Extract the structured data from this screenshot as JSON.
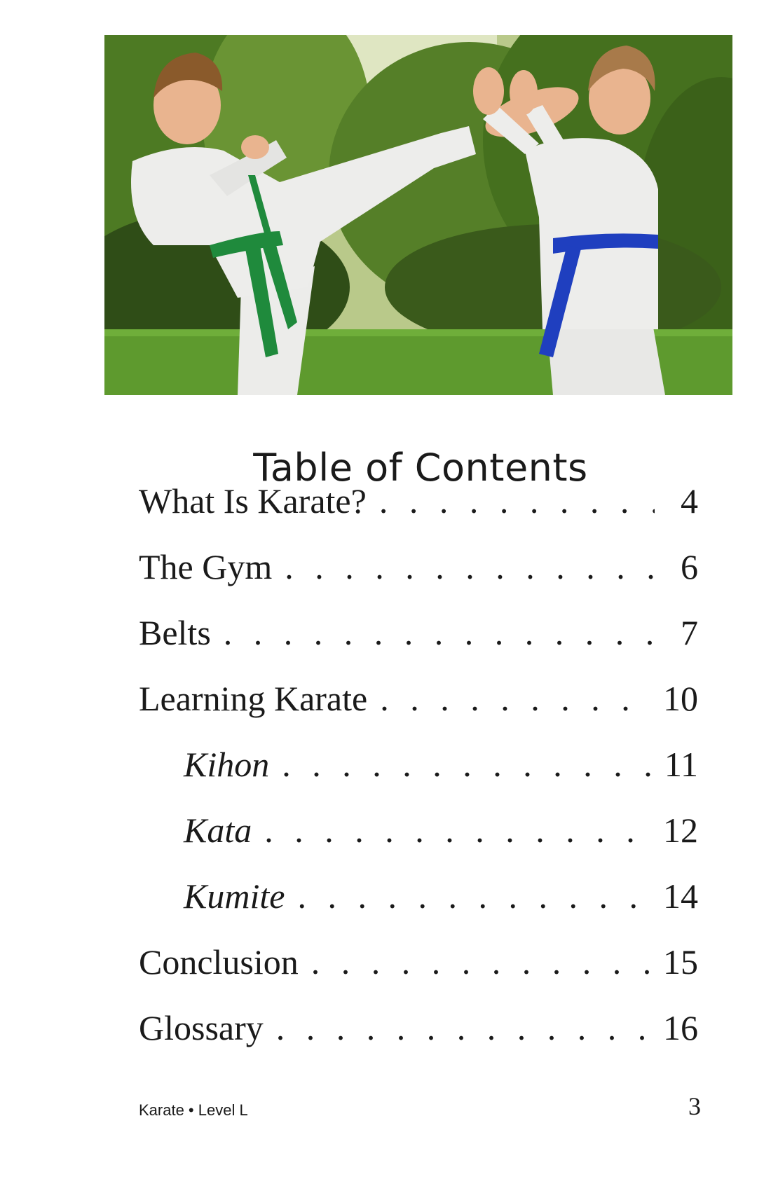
{
  "toc": {
    "title": "Table of Contents",
    "entries": [
      {
        "label": "What Is Karate?",
        "page": "4"
      },
      {
        "label": "The Gym",
        "page": "6"
      },
      {
        "label": "Belts",
        "page": "7"
      },
      {
        "label": "Learning Karate",
        "page": "10"
      },
      {
        "label": "Kihon",
        "page": "11"
      },
      {
        "label": "Kata",
        "page": "12"
      },
      {
        "label": "Kumite",
        "page": "14"
      },
      {
        "label": "Conclusion",
        "page": "15"
      },
      {
        "label": "Glossary",
        "page": "16"
      }
    ]
  },
  "footer": {
    "book_info": "Karate • Level L",
    "page_number": "3"
  },
  "photo": {
    "colors": {
      "grass": "#5e9a2e",
      "foliage": "#3f6b22",
      "gi": "#ededeb",
      "green_belt": "#1f8a3c",
      "blue_belt": "#1f3fbf",
      "skin": "#e9b48f",
      "hair": "#8a5a2b"
    }
  }
}
